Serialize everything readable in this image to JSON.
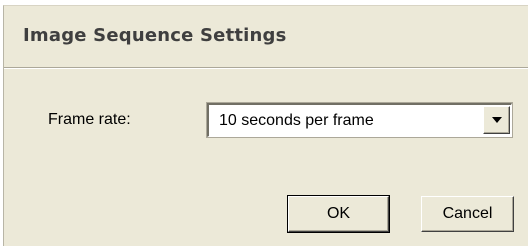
{
  "dialog": {
    "title": "Image Sequence Settings"
  },
  "frame_rate": {
    "label": "Frame rate:",
    "selected_value": "10 seconds per frame",
    "arrow_icon": "chevron-down-icon"
  },
  "buttons": {
    "ok_label": "OK",
    "cancel_label": "Cancel"
  }
}
